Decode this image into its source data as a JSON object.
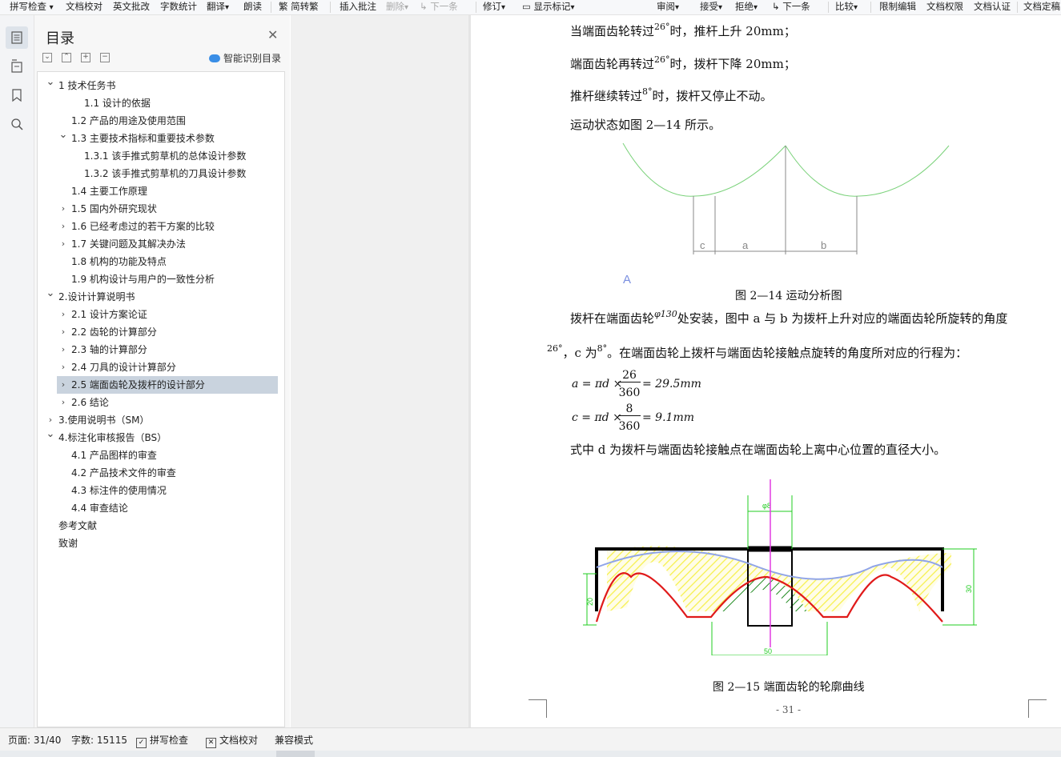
{
  "toolbar": {
    "items": [
      "拼写检查",
      "文档校对",
      "英文批改",
      "字数统计",
      "翻译",
      "朗读",
      "简转繁",
      "插入批注",
      "删除",
      "下一条",
      "修订",
      "显示标记",
      "审阅",
      "接受",
      "拒绝",
      "下一条",
      "比较",
      "限制编辑",
      "文档权限",
      "文档认证",
      "文档定稿"
    ]
  },
  "toc": {
    "title": "目录",
    "smart_label": "智能识别目录",
    "items": [
      {
        "label": "1  技术任务书",
        "chevron": "down"
      },
      {
        "label": "1.1  设计的依据",
        "chevron": ""
      },
      {
        "label": "1.2 产品的用途及使用范围",
        "chevron": ""
      },
      {
        "label": "1.3 主要技术指标和重要技术参数",
        "chevron": "down"
      },
      {
        "label": "1.3.1  该手推式剪草机的总体设计参数",
        "chevron": ""
      },
      {
        "label": "1.3.2  该手推式剪草机的刀具设计参数",
        "chevron": ""
      },
      {
        "label": "1.4 主要工作原理",
        "chevron": ""
      },
      {
        "label": "1.5 国内外研究现状",
        "chevron": "right"
      },
      {
        "label": "1.6 已经考虑过的若干方案的比较",
        "chevron": "right"
      },
      {
        "label": "1.7 关键问题及其解决办法",
        "chevron": "right"
      },
      {
        "label": "1.8    机构的功能及特点",
        "chevron": ""
      },
      {
        "label": "1.9 机构设计与用户的一致性分析",
        "chevron": ""
      },
      {
        "label": "2.设计计算说明书",
        "chevron": "down"
      },
      {
        "label": "2.1  设计方案论证",
        "chevron": "right"
      },
      {
        "label": "2.2  齿轮的计算部分",
        "chevron": "right"
      },
      {
        "label": "2.3  轴的计算部分",
        "chevron": "right"
      },
      {
        "label": "2.4  刀具的设计计算部分",
        "chevron": "right"
      },
      {
        "label": "2.5  端面齿轮及拨杆的设计部分",
        "chevron": "right"
      },
      {
        "label": "2.6  结论",
        "chevron": "right"
      },
      {
        "label": "3.使用说明书（SM）",
        "chevron": "right"
      },
      {
        "label": "4.标注化审核报告（BS）",
        "chevron": "down"
      },
      {
        "label": "4.1  产品图样的审查",
        "chevron": ""
      },
      {
        "label": "4.2 产品技术文件的审查",
        "chevron": ""
      },
      {
        "label": "4.3  标注件的使用情况",
        "chevron": ""
      },
      {
        "label": "4.4  审查结论",
        "chevron": ""
      },
      {
        "label": "参考文献",
        "chevron": ""
      },
      {
        "label": "致谢",
        "chevron": ""
      }
    ],
    "selected": "2.5  端面齿轮及拨杆的设计部分"
  },
  "doc": {
    "line1_pre": "当端面齿轮转过",
    "line1_sup": "26°",
    "line1_post": "时，推杆上升 20mm；",
    "line2_pre": "端面齿轮再转过",
    "line2_sup": "26°",
    "line2_post": "时，拨杆下降 20mm；",
    "line3_pre": "推杆继续转过",
    "line3_sup": "8°",
    "line3_post": "时，拨杆又停止不动。",
    "line4": "运动状态如图 2—14 所示。",
    "fig1_labels": {
      "c": "c",
      "a": "a",
      "b": "b",
      "mark": "A"
    },
    "caption1": "图 2—14  运动分析图",
    "para_pre": "拨杆在端面齿轮",
    "para_sup": "φ130",
    "para_post": "处安装，图中 a 与 b 为拨杆上升对应的端面齿轮所旋转的角度",
    "para2_sup1": "26°",
    "para2_mid": "，c 为",
    "para2_sup2": "8°",
    "para2_post": "。在端面齿轮上拨杆与端面齿轮接触点旋转的角度所对应的行程为：",
    "eq1_lhs": "a = πd ×",
    "eq1_num": "26",
    "eq1_den": "360",
    "eq1_rhs": "= 29.5mm",
    "eq2_lhs": "c = πd ×",
    "eq2_num": "8",
    "eq2_den": "360",
    "eq2_rhs": "= 9.1mm",
    "line_d": "式中 d 为拨杆与端面齿轮接触点在端面齿轮上离中心位置的直径大小。",
    "fig2_labels": {
      "top": "φ8",
      "left": "20",
      "right": "30",
      "bottom": "50"
    },
    "caption2": "图 2—15  端面齿轮的轮廓曲线",
    "page_number": "- 31 -"
  },
  "status": {
    "page": "页面: 31/40",
    "words": "字数: 15115",
    "spell": "拼写检查",
    "proof": "文档校对",
    "compat": "兼容模式"
  },
  "colors": {
    "selected_bg": "#c9d3de",
    "fig_green": "#7bd27b",
    "fig_yellow": "#f6f04a",
    "fig_red": "#e01a1a",
    "fig_magenta": "#e23be2",
    "fig_blue": "#8fa4e8"
  }
}
